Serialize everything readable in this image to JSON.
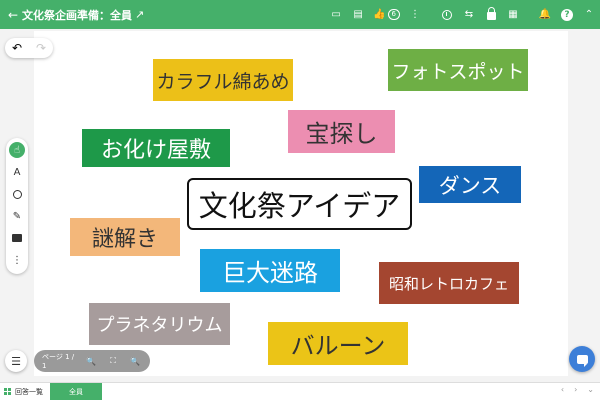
{
  "header": {
    "title": "文化祭企画準備：全員",
    "back_icon": "←",
    "share_icon": "↗",
    "like_count": "6",
    "icons": {
      "present": "▭",
      "comment": "▤",
      "like": "👍",
      "more": "⋮",
      "swap": "⇆",
      "podium": "▦",
      "bell": "🔔",
      "help": "?",
      "collapse": "⌃"
    }
  },
  "toolbar": {
    "undo": "↶",
    "redo": "↷",
    "select": "☝",
    "text": "A",
    "pen": "✎",
    "more": "⋮"
  },
  "pager": {
    "page_label": "ページ 1 / 1",
    "zoom_out": "🔍",
    "fit": "⛶",
    "zoom_in": "🔍"
  },
  "list_icon": "☰",
  "notes": [
    {
      "text": "文化祭アイデア",
      "color": "#ffffff",
      "text_color": "#111111"
    },
    {
      "text": "カラフル綿あめ",
      "color": "#ecc018",
      "text_color": "#333333"
    },
    {
      "text": "フォトスポット",
      "color": "#6eaf45",
      "text_color": "#ffffff"
    },
    {
      "text": "お化け屋敷",
      "color": "#1e9949",
      "text_color": "#ffffff"
    },
    {
      "text": "宝探し",
      "color": "#ec8eb1",
      "text_color": "#333333"
    },
    {
      "text": "ダンス",
      "color": "#1466b8",
      "text_color": "#ffffff"
    },
    {
      "text": "謎解き",
      "color": "#f3b77a",
      "text_color": "#333333"
    },
    {
      "text": "巨大迷路",
      "color": "#1aa1e0",
      "text_color": "#ffffff"
    },
    {
      "text": "昭和レトロカフェ",
      "color": "#a44630",
      "text_color": "#ffffff"
    },
    {
      "text": "プラネタリウム",
      "color": "#a79c9c",
      "text_color": "#ffffff"
    },
    {
      "text": "バルーン",
      "color": "#ebc417",
      "text_color": "#333333"
    }
  ],
  "footer": {
    "tab_list": "回答一覧",
    "tab_all": "全員",
    "nav_prev": "‹",
    "nav_next": "›",
    "expand": "⌄"
  }
}
